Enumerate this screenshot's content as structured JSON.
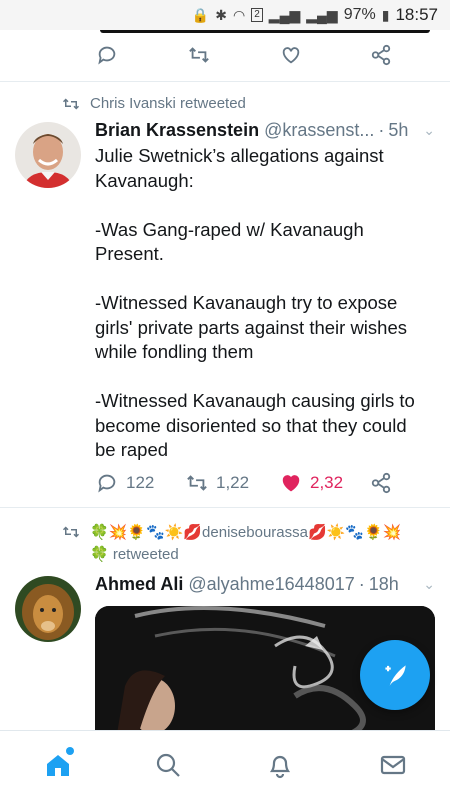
{
  "status_bar": {
    "battery": "97%",
    "time": "18:57",
    "sim": "2"
  },
  "tweets": [
    {
      "retweeted_by": "Chris Ivanski retweeted",
      "name": "Brian Krassenstein",
      "handle": "@krassenst...",
      "time_sep": "·",
      "time": "5h",
      "text": "Julie Swetnick’s allegations against Kavanaugh:\n\n-Was Gang-raped w/ Kavanaugh Present.\n\n-Witnessed Kavanaugh try to expose girls' private parts against their wishes while fondling them\n\n-Witnessed Kavanaugh causing girls to become disoriented so that they could be raped",
      "replies": "122",
      "retweets": "1,22",
      "likes": "2,32",
      "liked": true
    },
    {
      "retweeted_by_line1": "🍀💥🌻🐾☀️💋denisebourassa💋☀️🐾🌻💥",
      "retweeted_by_line2": "🍀 retweeted",
      "name": "Ahmed Ali",
      "handle": "@alyahme16448017",
      "time_sep": "·",
      "time": "18h"
    }
  ],
  "colors": {
    "accent": "#1da1f2",
    "like": "#e0245e",
    "muted": "#657786"
  },
  "icons": {
    "reply": "reply-icon",
    "retweet": "retweet-icon",
    "like": "heart-icon",
    "share": "share-icon",
    "compose": "compose-feather-icon",
    "home": "home-icon",
    "search": "search-icon",
    "notifications": "bell-icon",
    "messages": "envelope-icon"
  }
}
